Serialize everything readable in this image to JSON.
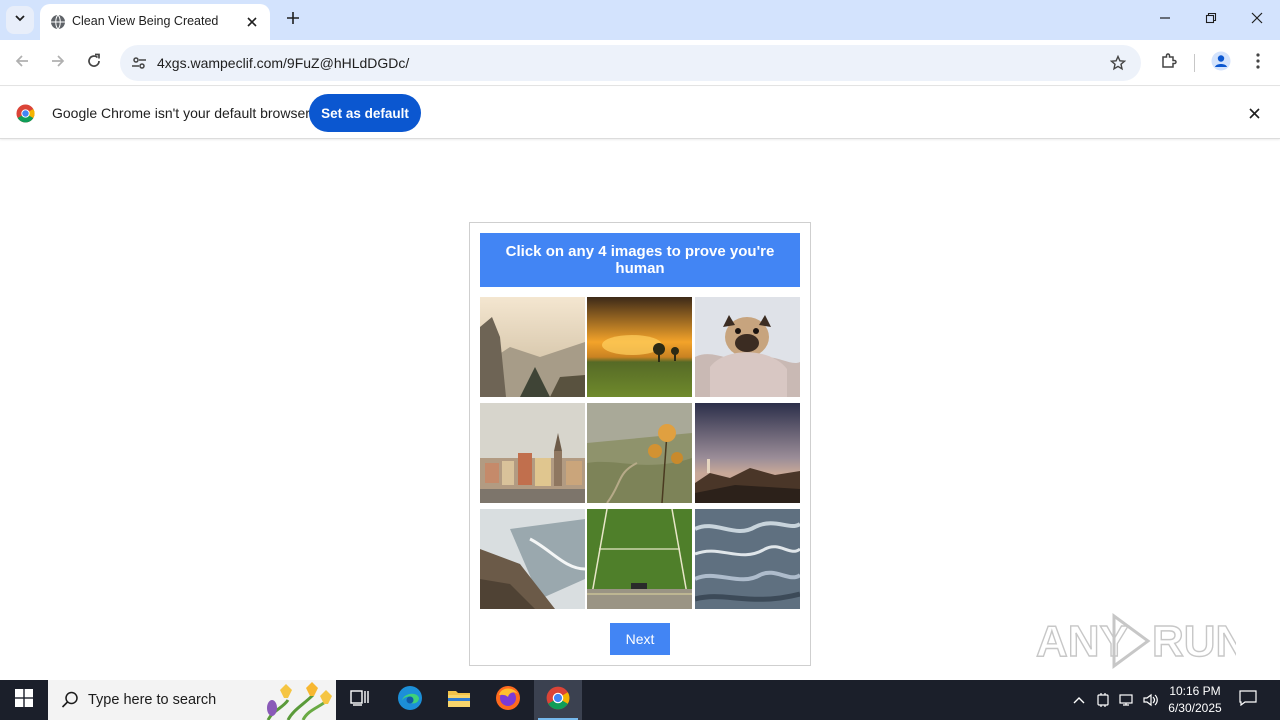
{
  "browser": {
    "tab_title": "Clean View Being Created",
    "url": "4xgs.wampeclif.com/9FuZ@hHLdDGDc/"
  },
  "infobar": {
    "message": "Google Chrome isn't your default browser",
    "button_label": "Set as default"
  },
  "captcha": {
    "instruction": "Click on any 4 images to prove you're human",
    "header_color": "#4285f4",
    "images": [
      "misty-valley-cliff",
      "savanna-sunset-trees",
      "pug-in-blanket",
      "old-town-skyline",
      "thistle-over-hills",
      "person-on-rocky-summit",
      "coastal-cliff-waves",
      "green-field-with-car",
      "aerial-wave-texture"
    ],
    "next_label": "Next"
  },
  "watermark": "ANY RUN",
  "taskbar": {
    "search_placeholder": "Type here to search",
    "time": "10:16 PM",
    "date": "6/30/2025"
  }
}
